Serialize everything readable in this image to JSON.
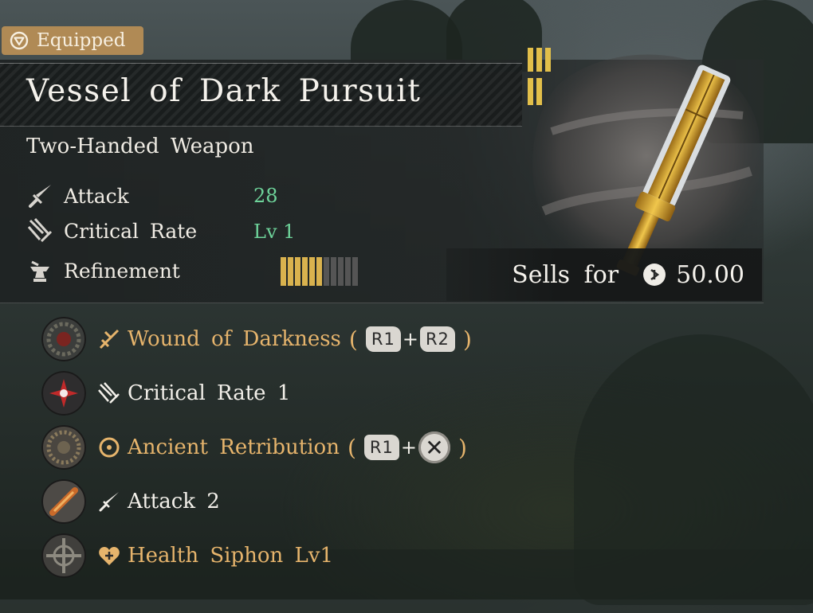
{
  "badge": {
    "label": "Equipped",
    "icon": "triangle-badge-icon"
  },
  "item": {
    "name": "Vessel of Dark Pursuit",
    "type": "Two-Handed Weapon",
    "rank_icon": "tier-bars-icon"
  },
  "stats": [
    {
      "label": "Attack",
      "value": "28",
      "icon": "sword-icon"
    },
    {
      "label": "Critical Rate",
      "value": "Lv 1",
      "icon": "critical-slash-icon"
    },
    {
      "label": "Refinement",
      "icon": "anvil-icon",
      "refinement_filled": 6,
      "refinement_total": 11
    }
  ],
  "sell": {
    "label": "Sells for",
    "value": "50.00",
    "icon": "coin-icon"
  },
  "skills": [
    {
      "name": "Wound of Darkness",
      "color": "gold",
      "icon": "slash-skill-icon",
      "combo": [
        "R1",
        "R2"
      ],
      "orb": "dark-gear-orb"
    },
    {
      "name": "Critical Rate 1",
      "color": "white",
      "icon": "critical-slash-icon",
      "combo": [],
      "orb": "red-spark-orb"
    },
    {
      "name": "Ancient Retribution",
      "color": "gold",
      "icon": "circle-target-icon",
      "combo": [
        "R1",
        "✕"
      ],
      "orb": "bronze-gear-orb"
    },
    {
      "name": "Attack 2",
      "color": "white",
      "icon": "sword-icon",
      "combo": [],
      "orb": "flame-blade-orb"
    },
    {
      "name": "Health Siphon Lv1",
      "color": "gold",
      "icon": "heart-plus-icon",
      "combo": [],
      "orb": "compass-orb"
    }
  ],
  "colors": {
    "accent_gold": "#e6b46c",
    "stat_green": "#6ed39a",
    "badge_bg": "#b08a55",
    "refine_filled": "#d9b24e",
    "refine_empty": "#555555"
  }
}
